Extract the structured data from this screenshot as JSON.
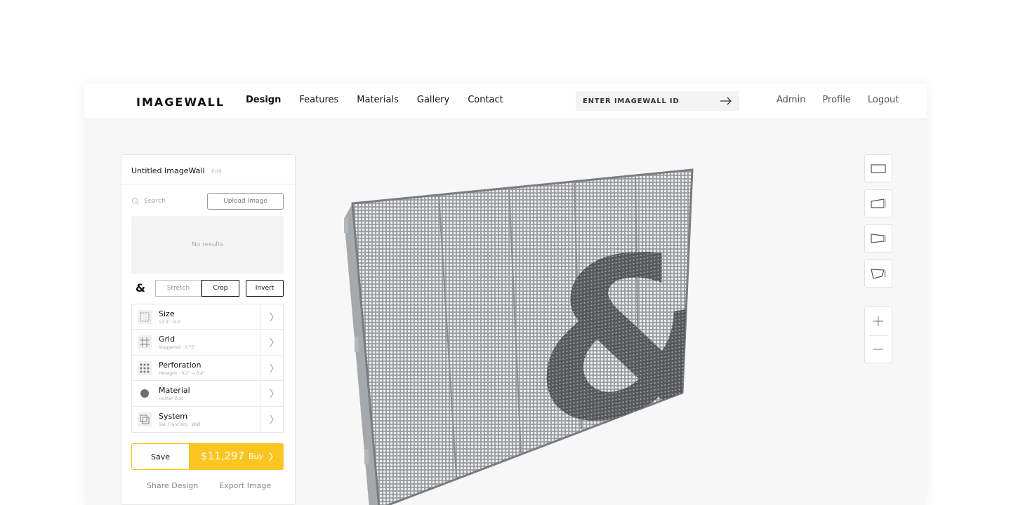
{
  "app": {
    "logo": "IMAGEWALL"
  },
  "nav": {
    "items": [
      "Design",
      "Features",
      "Materials",
      "Gallery",
      "Contact"
    ],
    "active": "Design"
  },
  "idsearch": {
    "placeholder": "ENTER IMAGEWALL ID"
  },
  "rightnav": {
    "items": [
      "Admin",
      "Profile",
      "Logout"
    ]
  },
  "panel": {
    "title": "Untitled ImageWall",
    "edit_label": "Edit",
    "search_placeholder": "Search",
    "upload_label": "Upload Image",
    "no_results": "No results",
    "glyph": "&",
    "fit_modes": [
      "Stretch",
      "Crop"
    ],
    "fit_selected": "Crop",
    "invert_label": "Invert",
    "options": [
      {
        "name": "Size",
        "sub": "12.0' · 9.0'",
        "icon": "size-icon"
      },
      {
        "name": "Grid",
        "sub": "Staggered · 0.75\"",
        "icon": "grid-icon"
      },
      {
        "name": "Perforation",
        "sub": "Hexagon · 0.2\" → 0.4\"",
        "icon": "perforation-icon"
      },
      {
        "name": "Material",
        "sub": "Hunter Zinc",
        "icon": "material-icon"
      },
      {
        "name": "System",
        "sub": "San Francisco · Wall",
        "icon": "system-icon"
      }
    ],
    "save_label": "Save",
    "price": "$11,297",
    "buy_label": "Buy",
    "share_label": "Share Design",
    "export_label": "Export Image"
  },
  "colors": {
    "accent": "#fbc520",
    "panel_metal": "#8c8f91"
  },
  "viewtools": [
    "front-view-icon",
    "left-perspective-icon",
    "right-perspective-icon",
    "low-perspective-icon"
  ],
  "zoomtools": [
    "zoom-in-icon",
    "zoom-out-icon"
  ]
}
